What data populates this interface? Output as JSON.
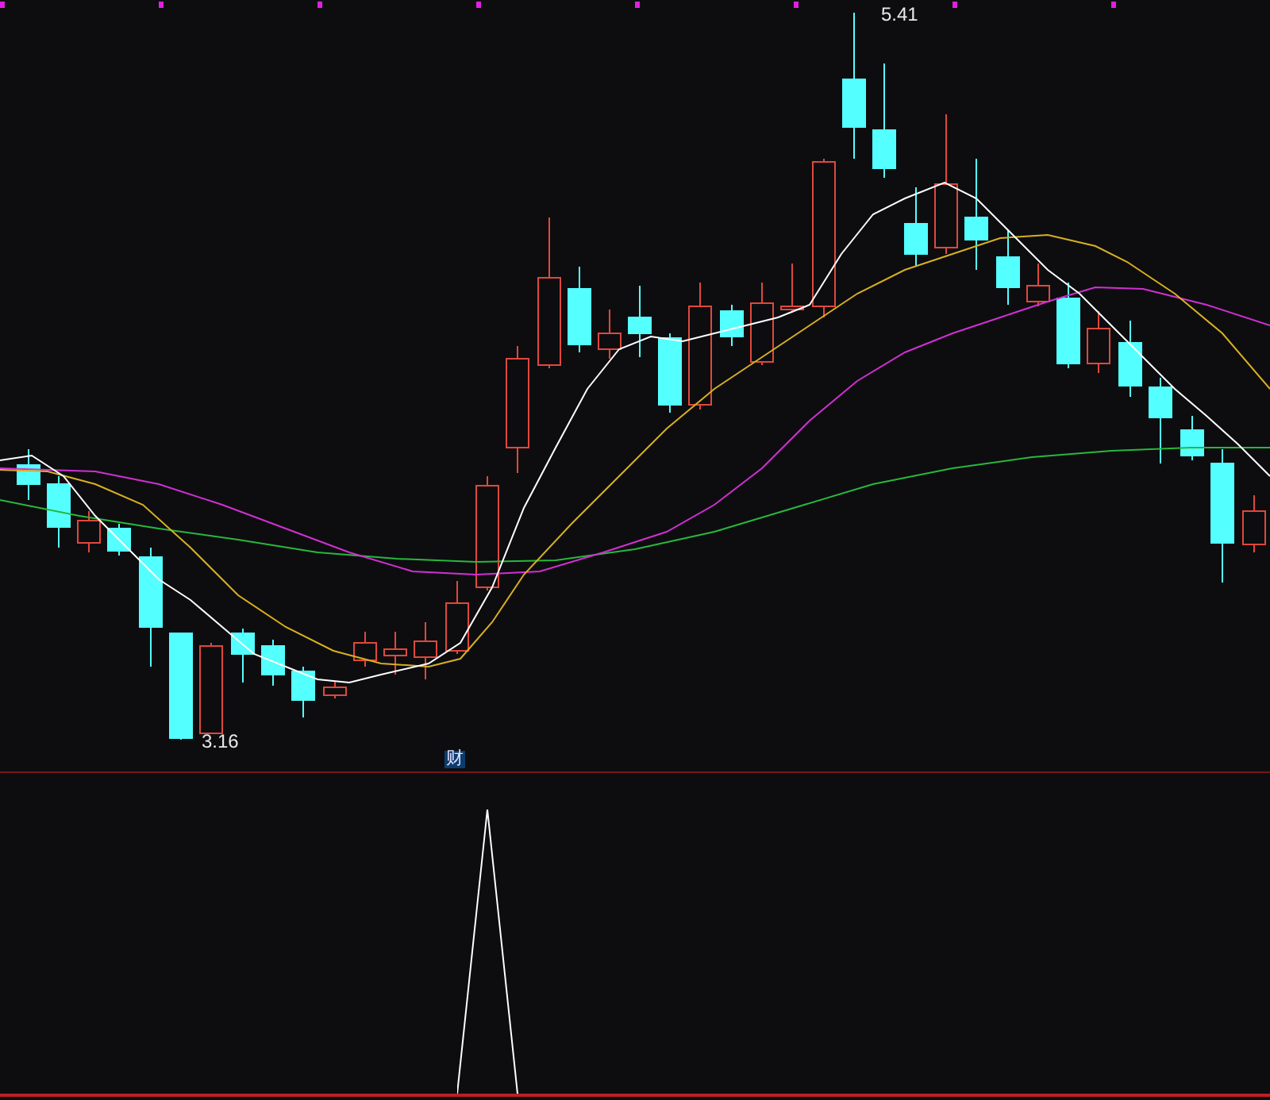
{
  "price_chart": {
    "high_label": "5.41",
    "low_label": "3.16"
  },
  "event_marker": {
    "label": "财"
  }
}
